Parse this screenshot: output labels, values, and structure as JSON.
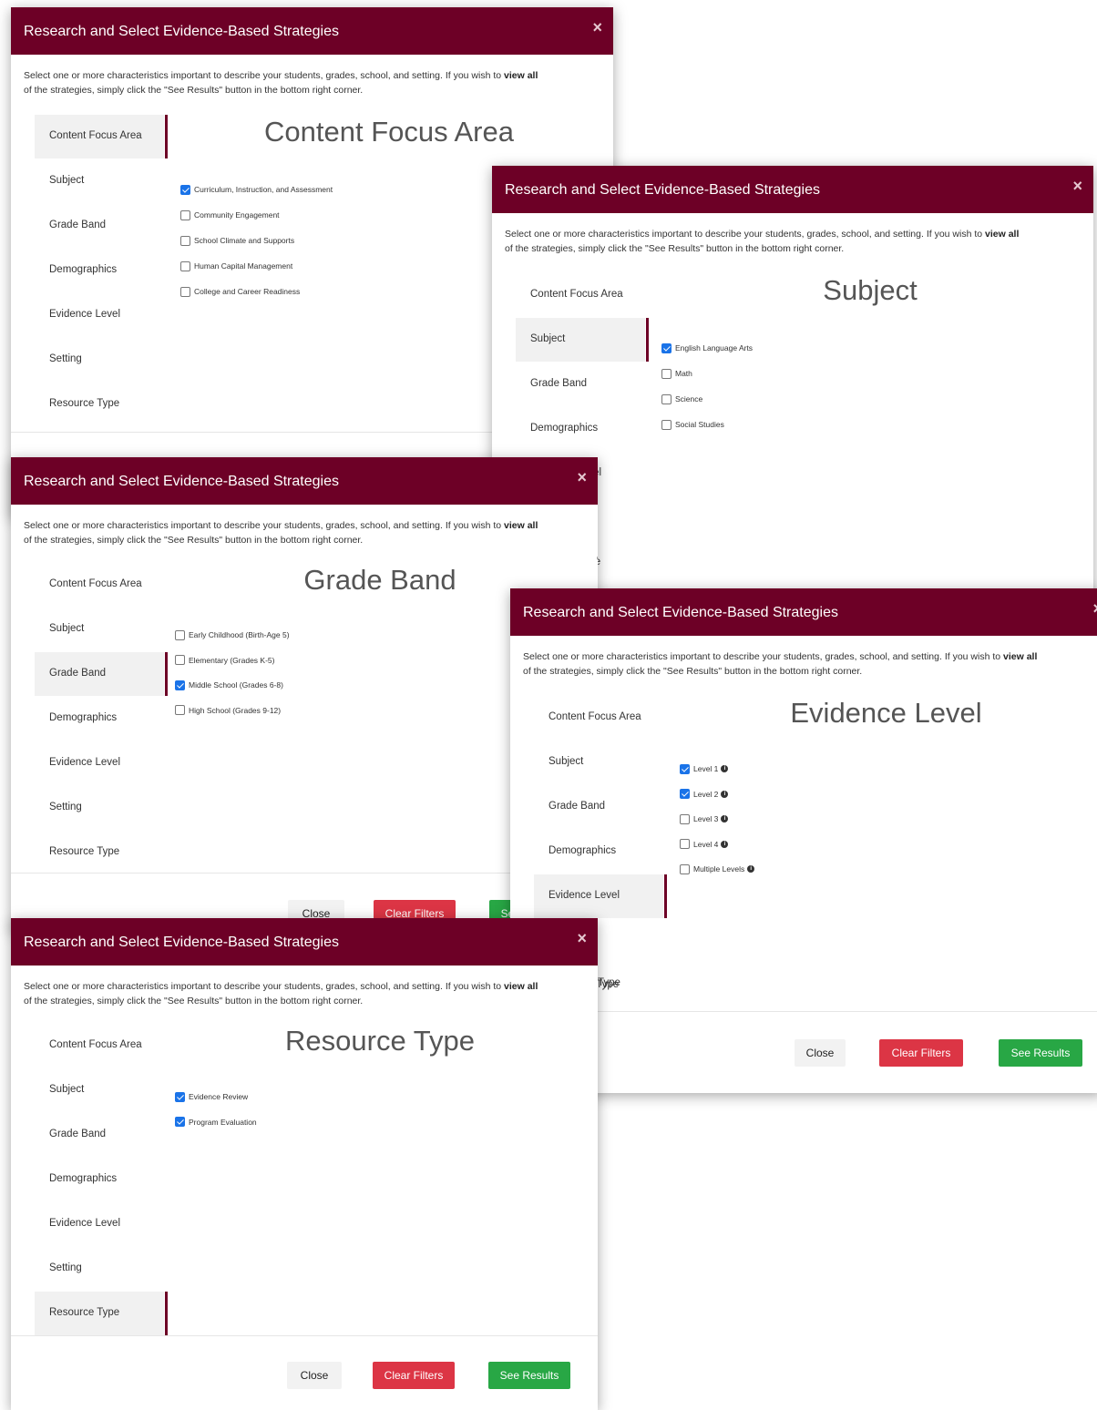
{
  "dialog": {
    "title": "Research and Select Evidence-Based Strategies",
    "close_glyph": "×",
    "intro_pre": "Select one or more characteristics important to describe your students, grades, school, and setting. If you wish to ",
    "intro_bold": "view all",
    "intro_post": "\nof the strategies, simply click the \"See Results\" button in the bottom right corner."
  },
  "nav": [
    "Content Focus Area",
    "Subject",
    "Grade Band",
    "Demographics",
    "Evidence Level",
    "Setting",
    "Resource Type"
  ],
  "buttons": {
    "close": "Close",
    "clear": "Clear Filters",
    "see": "See Results",
    "see_partial": "Se"
  },
  "fragments": {
    "level_tail": "l",
    "setting_tail": "e",
    "type_tail": "Type"
  },
  "screens": [
    {
      "section_title": "Content Focus Area",
      "active_nav": "Content Focus Area",
      "options": [
        {
          "label": "Curriculum, Instruction, and Assessment",
          "checked": true
        },
        {
          "label": "Community Engagement",
          "checked": false
        },
        {
          "label": "School Climate and Supports",
          "checked": false
        },
        {
          "label": "Human Capital Management",
          "checked": false
        },
        {
          "label": "College and Career Readiness",
          "checked": false
        }
      ]
    },
    {
      "section_title": "Subject",
      "active_nav": "Subject",
      "options": [
        {
          "label": "English Language Arts",
          "checked": true
        },
        {
          "label": "Math",
          "checked": false
        },
        {
          "label": "Science",
          "checked": false
        },
        {
          "label": "Social Studies",
          "checked": false
        }
      ]
    },
    {
      "section_title": "Grade Band",
      "active_nav": "Grade Band",
      "options": [
        {
          "label": "Early Childhood (Birth-Age 5)",
          "checked": false
        },
        {
          "label": "Elementary (Grades K-5)",
          "checked": false
        },
        {
          "label": "Middle School (Grades 6-8)",
          "checked": true
        },
        {
          "label": "High School (Grades 9-12)",
          "checked": false
        }
      ]
    },
    {
      "section_title": "Evidence Level",
      "active_nav": "Evidence Level",
      "options": [
        {
          "label": "Level 1",
          "checked": true,
          "info": true
        },
        {
          "label": "Level 2",
          "checked": true,
          "info": true
        },
        {
          "label": "Level 3",
          "checked": false,
          "info": true
        },
        {
          "label": "Level 4",
          "checked": false,
          "info": true
        },
        {
          "label": "Multiple Levels",
          "checked": false,
          "info": true
        }
      ]
    },
    {
      "section_title": "Resource Type",
      "active_nav": "Resource Type",
      "options": [
        {
          "label": "Evidence Review",
          "checked": true
        },
        {
          "label": "Program Evaluation",
          "checked": true
        }
      ]
    }
  ],
  "icons": {
    "close": "close-icon",
    "info": "info-icon",
    "checkbox": "checkbox"
  },
  "colors": {
    "header": "#6d0026",
    "clear_button": "#dc3545",
    "see_button": "#28a745",
    "checkbox_checked": "#1a73e8"
  }
}
